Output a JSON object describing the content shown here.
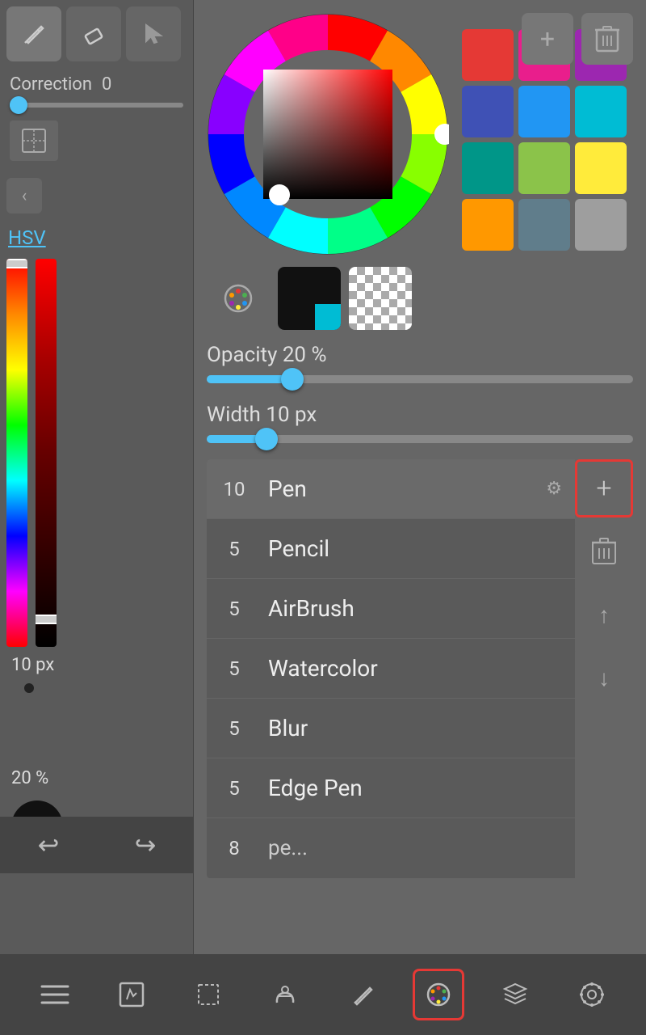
{
  "left_panel": {
    "tools": [
      {
        "label": "✏",
        "active": true,
        "name": "pen-tool"
      },
      {
        "label": "◧",
        "active": false,
        "name": "eraser-tool"
      },
      {
        "label": "▷",
        "active": false,
        "name": "select-tool"
      }
    ],
    "correction_label": "Correction",
    "correction_value": "0",
    "snapping_label": "Sn",
    "size_value": "10 px",
    "opacity_value": "20 %",
    "hsv_label": "HSV",
    "undo_icon": "↩",
    "redo_icon": "↪"
  },
  "color_picker": {
    "presets": [
      {
        "color": "#e53935",
        "name": "red"
      },
      {
        "color": "#e91e8c",
        "name": "pink"
      },
      {
        "color": "#9c27b0",
        "name": "purple"
      },
      {
        "color": "#3f51b5",
        "name": "indigo"
      },
      {
        "color": "#2196f3",
        "name": "blue"
      },
      {
        "color": "#00bcd4",
        "name": "cyan"
      },
      {
        "color": "#009688",
        "name": "teal"
      },
      {
        "color": "#8bc34a",
        "name": "light-green"
      },
      {
        "color": "#ffeb3b",
        "name": "yellow"
      },
      {
        "color": "#ff9800",
        "name": "orange"
      },
      {
        "color": "#607d8b",
        "name": "blue-grey"
      },
      {
        "color": "#9e9e9e",
        "name": "grey"
      }
    ],
    "add_btn": "+",
    "delete_btn": "🗑"
  },
  "color_modes": [
    {
      "icon": "🎨",
      "label": "palette",
      "active": false
    },
    {
      "icon": "◼",
      "label": "solid-color",
      "active": true
    },
    {
      "icon": "⬜",
      "label": "transparent",
      "active": false
    }
  ],
  "opacity": {
    "label": "Opacity 20 %",
    "value": 20,
    "fill_percent": 20
  },
  "width": {
    "label": "Width 10 px",
    "value": 10,
    "fill_percent": 14
  },
  "brush_list": {
    "items": [
      {
        "num": "10",
        "name": "Pen",
        "active": true,
        "has_settings": true
      },
      {
        "num": "5",
        "name": "Pencil",
        "active": false,
        "has_settings": false
      },
      {
        "num": "5",
        "name": "AirBrush",
        "active": false,
        "has_settings": false
      },
      {
        "num": "5",
        "name": "Watercolor",
        "active": false,
        "has_settings": false
      },
      {
        "num": "5",
        "name": "Blur",
        "active": false,
        "has_settings": false
      },
      {
        "num": "5",
        "name": "Edge Pen",
        "active": false,
        "has_settings": false
      },
      {
        "num": "8",
        "name": "pe...",
        "active": false,
        "has_settings": false
      }
    ],
    "action_buttons": [
      {
        "icon": "+",
        "label": "add",
        "highlighted": true
      },
      {
        "icon": "🗑",
        "label": "delete",
        "highlighted": false
      },
      {
        "icon": "↑",
        "label": "move-up",
        "highlighted": false
      },
      {
        "icon": "↓",
        "label": "move-down",
        "highlighted": false
      }
    ]
  },
  "bottom_toolbar": {
    "buttons": [
      {
        "icon": "☰",
        "name": "menu",
        "highlighted": false,
        "active": false
      },
      {
        "icon": "✎",
        "name": "edit",
        "highlighted": false,
        "active": false
      },
      {
        "icon": "⬚",
        "name": "selection",
        "highlighted": false,
        "active": false
      },
      {
        "icon": "◇",
        "name": "shape",
        "highlighted": false,
        "active": false
      },
      {
        "icon": "✏",
        "name": "brush",
        "highlighted": false,
        "active": false
      },
      {
        "icon": "🎨",
        "name": "color",
        "highlighted": true,
        "active": true
      },
      {
        "icon": "◈",
        "name": "layers",
        "highlighted": false,
        "active": false
      },
      {
        "icon": "⊙",
        "name": "settings",
        "highlighted": false,
        "active": false
      }
    ]
  }
}
